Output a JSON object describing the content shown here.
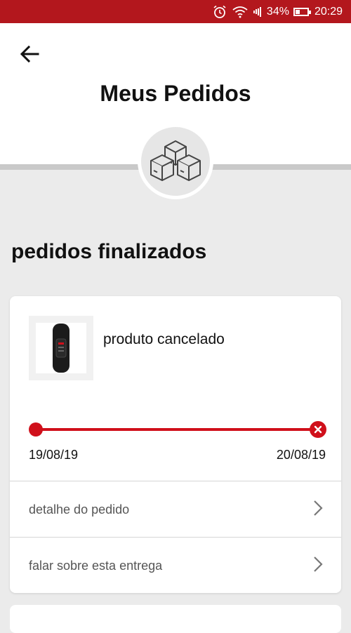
{
  "status_bar": {
    "battery": "34%",
    "time": "20:29",
    "icons": [
      "alarm-icon",
      "wifi-icon",
      "signal-icon",
      "battery-icon"
    ],
    "color": "#b3171d"
  },
  "header": {
    "title": "Meus Pedidos",
    "back_icon": "arrow-left-icon",
    "badge_icon": "boxes-icon"
  },
  "section": {
    "title": "pedidos finalizados"
  },
  "order": {
    "status": "produto cancelado",
    "product_icon": "smart-band-icon",
    "start_date": "19/08/19",
    "end_date": "20/08/19",
    "progress_color": "#d0101b",
    "links": [
      {
        "label": "detalhe do pedido",
        "icon": "chevron-right-icon"
      },
      {
        "label": "falar sobre esta entrega",
        "icon": "chevron-right-icon"
      }
    ]
  }
}
